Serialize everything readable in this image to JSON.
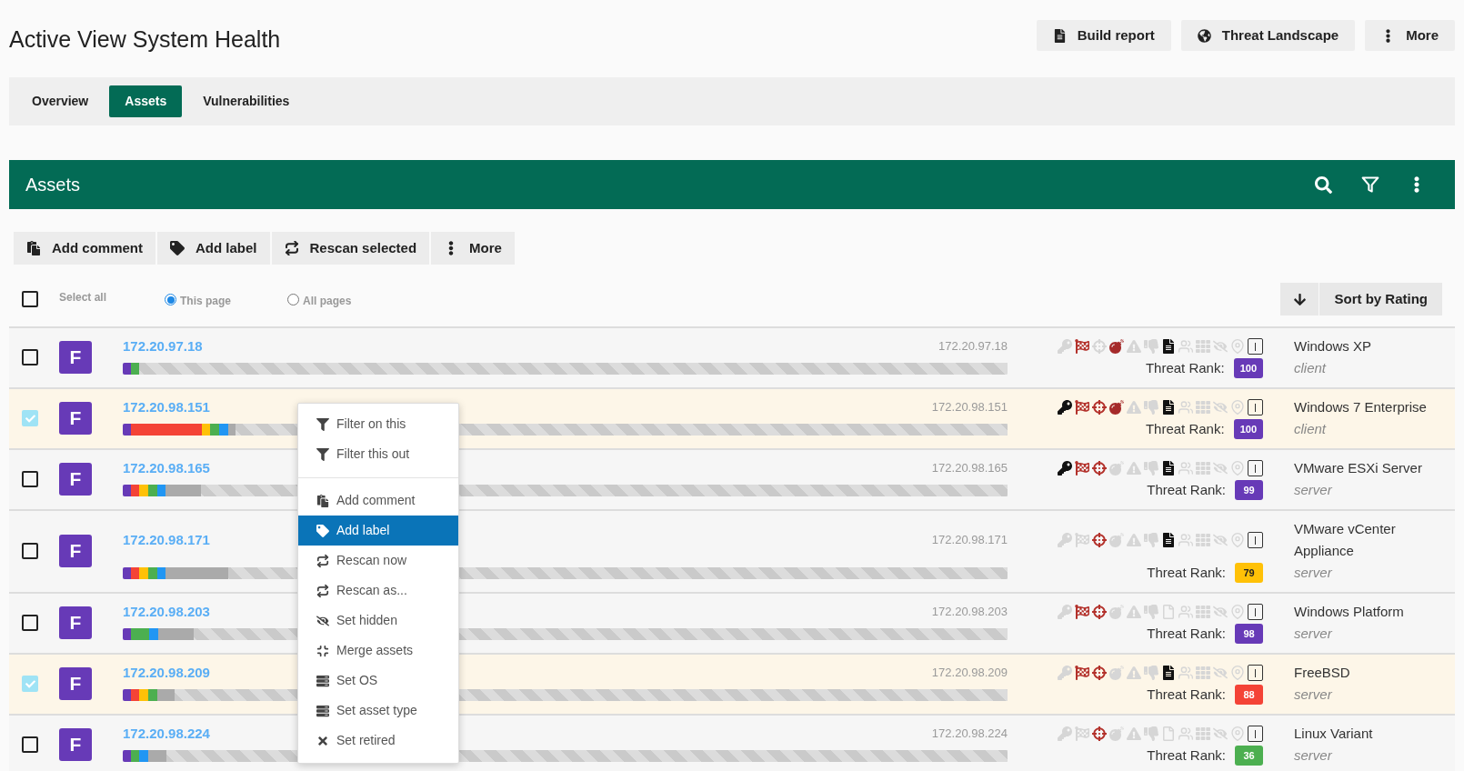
{
  "page": {
    "title": "Active View System Health"
  },
  "header_actions": [
    {
      "kind": "document",
      "label": "Build report"
    },
    {
      "kind": "globe",
      "label": "Threat Landscape"
    },
    {
      "kind": "more",
      "label": "More"
    }
  ],
  "tabs": [
    {
      "label": "Overview",
      "selected": false
    },
    {
      "label": "Assets",
      "selected": true
    },
    {
      "label": "Vulnerabilities",
      "selected": false
    }
  ],
  "panel": {
    "title": "Assets"
  },
  "toolbar": [
    {
      "kind": "comment",
      "label": "Add comment"
    },
    {
      "kind": "label",
      "label": "Add label"
    },
    {
      "kind": "rescan",
      "label": "Rescan selected"
    },
    {
      "kind": "more",
      "label": "More"
    }
  ],
  "selection": {
    "select_all": {
      "label": "Select all",
      "checked": false
    },
    "scope": [
      {
        "label": "This page",
        "selected": true
      },
      {
        "label": "All pages",
        "selected": false
      }
    ]
  },
  "sort": {
    "label": "Sort by Rating"
  },
  "rows": [
    {
      "checked": false,
      "grade": "F",
      "address": "172.20.97.18",
      "ip": "172.20.97.18",
      "segments": [
        {
          "color": "#673ab7",
          "level": 0.009
        },
        {
          "color": "#4caf50",
          "level": 0.01
        }
      ],
      "indicators": [
        {
          "kind": "key",
          "on": false
        },
        {
          "kind": "flag",
          "on": true
        },
        {
          "kind": "crosshair",
          "on": false
        },
        {
          "kind": "bomb",
          "on": true
        },
        {
          "kind": "warning",
          "on": false
        },
        {
          "kind": "thumbs-down",
          "on": false
        },
        {
          "kind": "document",
          "on": true
        },
        {
          "kind": "users",
          "on": false
        },
        {
          "kind": "grid",
          "on": false
        },
        {
          "kind": "hidden",
          "on": false
        },
        {
          "kind": "pin",
          "on": false
        }
      ],
      "threat_rank_label": "Threat Rank:",
      "threat_rank": {
        "value": "100",
        "color": "#673ab7"
      },
      "os": "Windows XP",
      "type": "client"
    },
    {
      "checked": true,
      "grade": "F",
      "address": "172.20.98.151",
      "ip": "172.20.98.151",
      "segments": [
        {
          "color": "#673ab7",
          "level": 0.009
        },
        {
          "color": "#f44336",
          "level": 0.08
        },
        {
          "color": "#ffc107",
          "level": 0.01
        },
        {
          "color": "#4caf50",
          "level": 0.01
        },
        {
          "color": "#2196f3",
          "level": 0.01
        },
        {
          "color": "#aaaaaa",
          "level": 0.009
        }
      ],
      "indicators": [
        {
          "kind": "key",
          "on": true
        },
        {
          "kind": "flag",
          "on": true
        },
        {
          "kind": "crosshair",
          "on": true
        },
        {
          "kind": "bomb",
          "on": true
        },
        {
          "kind": "warning",
          "on": false
        },
        {
          "kind": "thumbs-down",
          "on": false
        },
        {
          "kind": "document",
          "on": true
        },
        {
          "kind": "users",
          "on": false
        },
        {
          "kind": "grid",
          "on": false
        },
        {
          "kind": "hidden",
          "on": false
        },
        {
          "kind": "pin",
          "on": false
        }
      ],
      "threat_rank_label": "Threat Rank:",
      "threat_rank": {
        "value": "100",
        "color": "#673ab7"
      },
      "os": "Windows 7 Enterprise",
      "type": "client"
    },
    {
      "checked": false,
      "grade": "F",
      "address": "172.20.98.165",
      "ip": "172.20.98.165",
      "segments": [
        {
          "color": "#673ab7",
          "level": 0.009
        },
        {
          "color": "#f44336",
          "level": 0.01
        },
        {
          "color": "#ffc107",
          "level": 0.01
        },
        {
          "color": "#4caf50",
          "level": 0.01
        },
        {
          "color": "#2196f3",
          "level": 0.009
        },
        {
          "color": "#aaaaaa",
          "level": 0.04
        }
      ],
      "indicators": [
        {
          "kind": "key",
          "on": true
        },
        {
          "kind": "flag",
          "on": true
        },
        {
          "kind": "crosshair",
          "on": true
        },
        {
          "kind": "bomb",
          "on": false
        },
        {
          "kind": "warning",
          "on": false
        },
        {
          "kind": "thumbs-down",
          "on": false
        },
        {
          "kind": "document",
          "on": true
        },
        {
          "kind": "users",
          "on": false
        },
        {
          "kind": "grid",
          "on": false
        },
        {
          "kind": "hidden",
          "on": false
        },
        {
          "kind": "pin",
          "on": false
        }
      ],
      "threat_rank_label": "Threat Rank:",
      "threat_rank": {
        "value": "99",
        "color": "#673ab7"
      },
      "os": "VMware ESXi Server",
      "type": "server"
    },
    {
      "checked": false,
      "grade": "F",
      "address": "172.20.98.171",
      "ip": "172.20.98.171",
      "segments": [
        {
          "color": "#673ab7",
          "level": 0.009
        },
        {
          "color": "#f44336",
          "level": 0.01
        },
        {
          "color": "#ffc107",
          "level": 0.01
        },
        {
          "color": "#4caf50",
          "level": 0.01
        },
        {
          "color": "#2196f3",
          "level": 0.009
        },
        {
          "color": "#aaaaaa",
          "level": 0.071
        }
      ],
      "indicators": [
        {
          "kind": "key",
          "on": false
        },
        {
          "kind": "flag",
          "on": false
        },
        {
          "kind": "crosshair",
          "on": true
        },
        {
          "kind": "bomb",
          "on": false
        },
        {
          "kind": "warning",
          "on": false
        },
        {
          "kind": "thumbs-down",
          "on": false
        },
        {
          "kind": "document",
          "on": true
        },
        {
          "kind": "users",
          "on": false
        },
        {
          "kind": "grid",
          "on": false
        },
        {
          "kind": "hidden",
          "on": false
        },
        {
          "kind": "pin",
          "on": false
        }
      ],
      "threat_rank_label": "Threat Rank:",
      "threat_rank": {
        "value": "79",
        "color": "#ffc107"
      },
      "os": "VMware vCenter Appliance",
      "type": "server"
    },
    {
      "checked": false,
      "grade": "F",
      "address": "172.20.98.203",
      "ip": "172.20.98.203",
      "segments": [
        {
          "color": "#673ab7",
          "level": 0.009
        },
        {
          "color": "#4caf50",
          "level": 0.021
        },
        {
          "color": "#2196f3",
          "level": 0.01
        },
        {
          "color": "#aaaaaa",
          "level": 0.04
        }
      ],
      "indicators": [
        {
          "kind": "key",
          "on": false
        },
        {
          "kind": "flag",
          "on": true
        },
        {
          "kind": "crosshair",
          "on": true
        },
        {
          "kind": "bomb",
          "on": false
        },
        {
          "kind": "warning",
          "on": false
        },
        {
          "kind": "thumbs-down",
          "on": false
        },
        {
          "kind": "document",
          "on": false
        },
        {
          "kind": "users",
          "on": false
        },
        {
          "kind": "grid",
          "on": false
        },
        {
          "kind": "hidden",
          "on": false
        },
        {
          "kind": "pin",
          "on": false
        }
      ],
      "threat_rank_label": "Threat Rank:",
      "threat_rank": {
        "value": "98",
        "color": "#673ab7"
      },
      "os": "Windows Platform",
      "type": "server"
    },
    {
      "checked": true,
      "grade": "F",
      "address": "172.20.98.209",
      "ip": "172.20.98.209",
      "segments": [
        {
          "color": "#673ab7",
          "level": 0.009
        },
        {
          "color": "#f44336",
          "level": 0.01
        },
        {
          "color": "#ffc107",
          "level": 0.01
        },
        {
          "color": "#4caf50",
          "level": 0.01
        },
        {
          "color": "#aaaaaa",
          "level": 0.02
        }
      ],
      "indicators": [
        {
          "kind": "key",
          "on": false
        },
        {
          "kind": "flag",
          "on": true
        },
        {
          "kind": "crosshair",
          "on": true
        },
        {
          "kind": "bomb",
          "on": false
        },
        {
          "kind": "warning",
          "on": false
        },
        {
          "kind": "thumbs-down",
          "on": false
        },
        {
          "kind": "document",
          "on": true
        },
        {
          "kind": "users",
          "on": false
        },
        {
          "kind": "grid",
          "on": false
        },
        {
          "kind": "hidden",
          "on": false
        },
        {
          "kind": "pin",
          "on": false
        }
      ],
      "threat_rank_label": "Threat Rank:",
      "threat_rank": {
        "value": "88",
        "color": "#f44336"
      },
      "os": "FreeBSD",
      "type": "server"
    },
    {
      "checked": false,
      "grade": "F",
      "address": "172.20.98.224",
      "ip": "172.20.98.224",
      "segments": [
        {
          "color": "#673ab7",
          "level": 0.009
        },
        {
          "color": "#4caf50",
          "level": 0.01
        },
        {
          "color": "#2196f3",
          "level": 0.01
        },
        {
          "color": "#aaaaaa",
          "level": 0.02
        }
      ],
      "indicators": [
        {
          "kind": "key",
          "on": false
        },
        {
          "kind": "flag",
          "on": false
        },
        {
          "kind": "crosshair",
          "on": true
        },
        {
          "kind": "bomb",
          "on": false
        },
        {
          "kind": "warning",
          "on": false
        },
        {
          "kind": "thumbs-down",
          "on": false
        },
        {
          "kind": "document",
          "on": false
        },
        {
          "kind": "users",
          "on": false
        },
        {
          "kind": "grid",
          "on": false
        },
        {
          "kind": "hidden",
          "on": false
        },
        {
          "kind": "pin",
          "on": false
        }
      ],
      "threat_rank_label": "Threat Rank:",
      "threat_rank": {
        "value": "36",
        "color": "#4caf50"
      },
      "os": "Linux Variant",
      "type": "server"
    }
  ],
  "context_menu": {
    "sections": [
      {
        "items": [
          {
            "kind": "filter",
            "label": "Filter on this",
            "selected": false
          },
          {
            "kind": "filter",
            "label": "Filter this out",
            "selected": false
          }
        ]
      },
      {
        "items": [
          {
            "kind": "comment",
            "label": "Add comment",
            "selected": false
          },
          {
            "kind": "label",
            "label": "Add label",
            "selected": true
          },
          {
            "kind": "rescan",
            "label": "Rescan now",
            "selected": false
          },
          {
            "kind": "rescan",
            "label": "Rescan as...",
            "selected": false
          },
          {
            "kind": "hide",
            "label": "Set hidden",
            "selected": false
          },
          {
            "kind": "merge",
            "label": "Merge assets",
            "selected": false
          },
          {
            "kind": "list",
            "label": "Set OS",
            "selected": false
          },
          {
            "kind": "list",
            "label": "Set asset type",
            "selected": false
          },
          {
            "kind": "retire",
            "label": "Set retired",
            "selected": false
          }
        ]
      }
    ]
  }
}
